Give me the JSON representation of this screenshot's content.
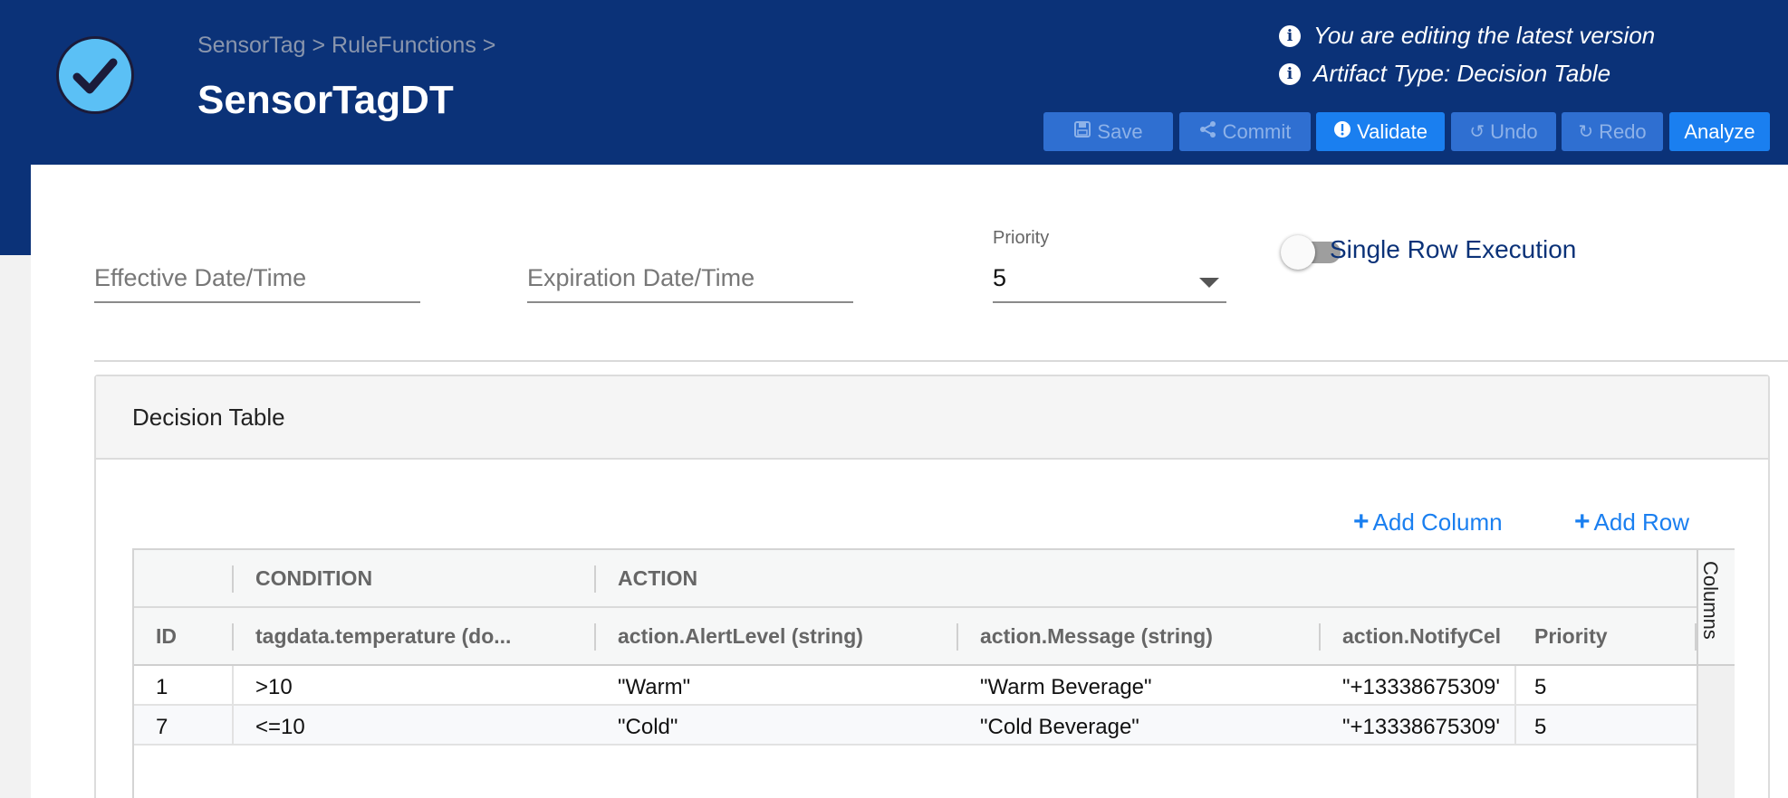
{
  "header": {
    "breadcrumb": "SensorTag > RuleFunctions >",
    "title": "SensorTagDT",
    "info_editing": "You are editing the latest version",
    "info_type": "Artifact Type: Decision Table",
    "colors": {
      "header_bg": "#0b3278",
      "accent": "#1a7ff0",
      "logo": "#5bc0f5"
    }
  },
  "toolbar": {
    "save": "Save",
    "commit": "Commit",
    "validate": "Validate",
    "undo": "Undo",
    "redo": "Redo",
    "analyze": "Analyze"
  },
  "form": {
    "effective_placeholder": "Effective Date/Time",
    "expiration_placeholder": "Expiration Date/Time",
    "priority_label": "Priority",
    "priority_value": "5",
    "single_row_label": "Single Row Execution",
    "single_row_enabled": false
  },
  "panel": {
    "title": "Decision Table",
    "add_column": "Add Column",
    "add_row": "Add Row",
    "columns_tab": "Columns",
    "groups": {
      "condition": "CONDITION",
      "action": "ACTION"
    },
    "headers": [
      "ID",
      "tagdata.temperature (do...",
      "action.AlertLevel (string)",
      "action.Message (string)",
      "action.NotifyCel",
      "Priority"
    ],
    "rows": [
      [
        "1",
        ">10",
        "\"Warm\"",
        "\"Warm Beverage\"",
        "\"+13338675309'",
        "5"
      ],
      [
        "7",
        "<=10",
        "\"Cold\"",
        "\"Cold Beverage\"",
        "\"+13338675309'",
        "5"
      ]
    ]
  }
}
